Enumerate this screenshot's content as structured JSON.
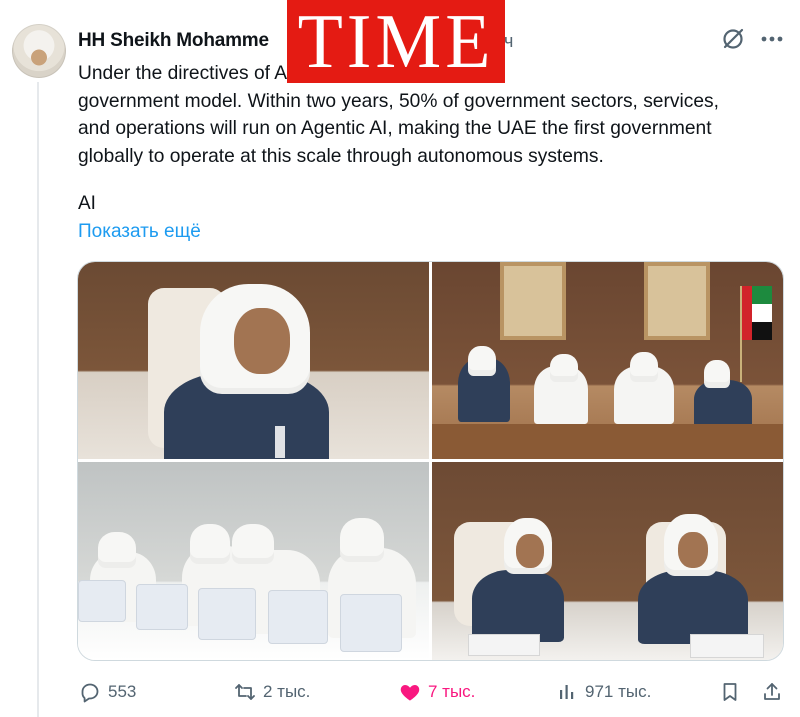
{
  "tweet": {
    "author": "HH Sheikh Mohammed",
    "author_display": "HH Sheikh Mohamme",
    "time": "ч",
    "text_lines": [
      "Under the directives of                           AE, we launch a new",
      "government model. Within two years, 50% of government sectors, services,",
      "and operations will run on Agentic AI, making the UAE the first government",
      "globally to operate at this scale through autonomous systems."
    ],
    "extra_text": "AI",
    "show_more": "Показать ещё"
  },
  "overlay": {
    "time_logo": "TIME",
    "color": "#e41b13"
  },
  "media": {
    "photos": [
      "photo-1",
      "photo-2",
      "photo-3",
      "photo-4"
    ]
  },
  "actions": {
    "replies": "553",
    "retweets": "2 тыс.",
    "likes": "7 тыс.",
    "views": "971 тыс."
  },
  "icons": {
    "grok": "grok-icon",
    "more": "more-icon",
    "reply": "reply-icon",
    "retweet": "retweet-icon",
    "like": "heart-icon",
    "views": "views-icon",
    "bookmark": "bookmark-icon",
    "share": "share-icon"
  },
  "colors": {
    "link": "#1d9bf0",
    "like": "#f91880",
    "muted": "#536471"
  }
}
